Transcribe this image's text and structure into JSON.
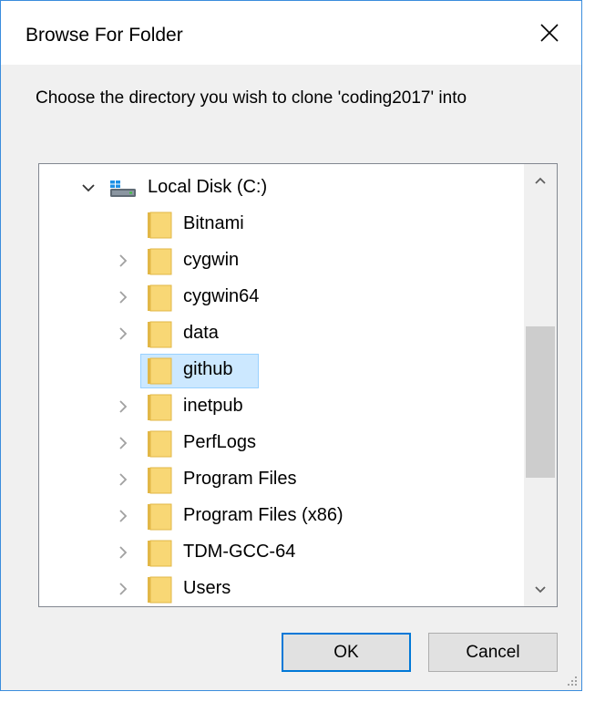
{
  "window": {
    "title": "Browse For Folder",
    "close_glyph": "✕"
  },
  "prompt": "Choose the directory you wish to clone 'coding2017' into",
  "tree": {
    "root": {
      "label": "Local Disk (C:)",
      "icon": "drive-icon",
      "expanded": true
    },
    "items": [
      {
        "label": "Bitnami",
        "has_children": false,
        "selected": false
      },
      {
        "label": "cygwin",
        "has_children": true,
        "selected": false
      },
      {
        "label": "cygwin64",
        "has_children": true,
        "selected": false
      },
      {
        "label": "data",
        "has_children": true,
        "selected": false
      },
      {
        "label": "github",
        "has_children": false,
        "selected": true
      },
      {
        "label": "inetpub",
        "has_children": true,
        "selected": false
      },
      {
        "label": "PerfLogs",
        "has_children": true,
        "selected": false
      },
      {
        "label": "Program Files",
        "has_children": true,
        "selected": false
      },
      {
        "label": "Program Files (x86)",
        "has_children": true,
        "selected": false
      },
      {
        "label": "TDM-GCC-64",
        "has_children": true,
        "selected": false
      },
      {
        "label": "Users",
        "has_children": true,
        "selected": false
      }
    ]
  },
  "buttons": {
    "ok": "OK",
    "cancel": "Cancel"
  },
  "colors": {
    "accent": "#0078d7",
    "selection": "#cce8ff",
    "folder": "#f8d775",
    "folder_dark": "#e2b746"
  }
}
